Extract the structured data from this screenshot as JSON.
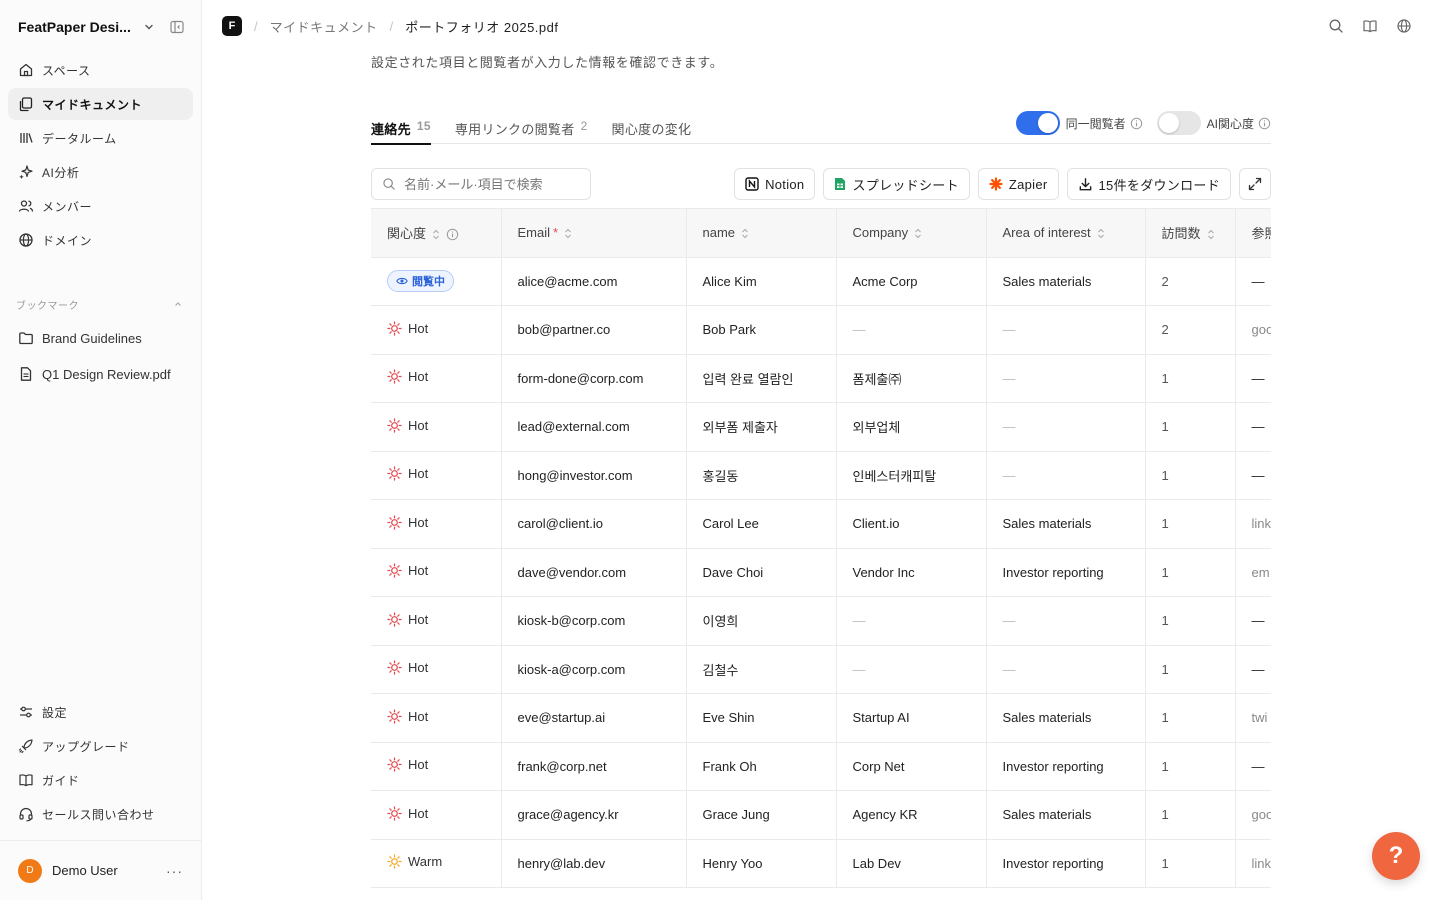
{
  "sidebar": {
    "workspace": "FeatPaper Desi...",
    "nav": [
      {
        "label": "スペース",
        "icon": "home-icon"
      },
      {
        "label": "マイドキュメント",
        "icon": "documents-icon"
      },
      {
        "label": "データルーム",
        "icon": "library-icon"
      },
      {
        "label": "AI分析",
        "icon": "sparkle-icon"
      },
      {
        "label": "メンバー",
        "icon": "users-icon"
      },
      {
        "label": "ドメイン",
        "icon": "globe-icon"
      }
    ],
    "bookmarks_title": "ブックマーク",
    "bookmarks": [
      {
        "label": "Brand Guidelines",
        "icon": "folder-icon"
      },
      {
        "label": "Q1 Design Review.pdf",
        "icon": "file-icon"
      }
    ],
    "bottom_nav": [
      {
        "label": "設定",
        "icon": "sliders-icon"
      },
      {
        "label": "アップグレード",
        "icon": "rocket-icon"
      },
      {
        "label": "ガイド",
        "icon": "book-icon"
      },
      {
        "label": "セールス問い合わせ",
        "icon": "headset-icon"
      }
    ],
    "user": {
      "initial": "D",
      "name": "Demo User",
      "more": "···"
    }
  },
  "topbar": {
    "logo": "F",
    "sep": "/",
    "crumbs": [
      "マイドキュメント",
      "ポートフォリオ 2025.pdf"
    ]
  },
  "main": {
    "description": "設定された項目と閲覧者が入力した情報を確認できます。",
    "tabs": [
      {
        "label": "連絡先",
        "count": "15"
      },
      {
        "label": "専用リンクの閲覧者",
        "count": "2"
      },
      {
        "label": "関心度の変化",
        "count": ""
      }
    ],
    "toggles": [
      {
        "label": "同一閲覧者",
        "on": true
      },
      {
        "label": "AI関心度",
        "on": false
      }
    ],
    "search_placeholder": "名前·メール·項目で検索",
    "buttons": {
      "notion": "Notion",
      "sheet": "スプレッドシート",
      "zapier": "Zapier",
      "download": "15件をダウンロード"
    },
    "columns": [
      "関心度",
      "Email",
      "name",
      "Company",
      "Area of interest",
      "訪問数",
      "参照"
    ],
    "email_required": "*",
    "rows": [
      {
        "interest": "閲覧中",
        "type": "viewing",
        "email": "alice@acme.com",
        "name": "Alice Kim",
        "company": "Acme Corp",
        "area": "Sales materials",
        "visits": "2",
        "ref": "—"
      },
      {
        "interest": "Hot",
        "type": "hot",
        "email": "bob@partner.co",
        "name": "Bob Park",
        "company": "—",
        "area": "—",
        "visits": "2",
        "ref": "goo"
      },
      {
        "interest": "Hot",
        "type": "hot",
        "email": "form-done@corp.com",
        "name": "입력 완료 열람인",
        "company": "폼제출㈜",
        "area": "—",
        "visits": "1",
        "ref": "—"
      },
      {
        "interest": "Hot",
        "type": "hot",
        "email": "lead@external.com",
        "name": "외부폼 제출자",
        "company": "외부업체",
        "area": "—",
        "visits": "1",
        "ref": "—"
      },
      {
        "interest": "Hot",
        "type": "hot",
        "email": "hong@investor.com",
        "name": "홍길동",
        "company": "인베스터캐피탈",
        "area": "—",
        "visits": "1",
        "ref": "—"
      },
      {
        "interest": "Hot",
        "type": "hot",
        "email": "carol@client.io",
        "name": "Carol Lee",
        "company": "Client.io",
        "area": "Sales materials",
        "visits": "1",
        "ref": "link"
      },
      {
        "interest": "Hot",
        "type": "hot",
        "email": "dave@vendor.com",
        "name": "Dave Choi",
        "company": "Vendor Inc",
        "area": "Investor reporting",
        "visits": "1",
        "ref": "em"
      },
      {
        "interest": "Hot",
        "type": "hot",
        "email": "kiosk-b@corp.com",
        "name": "이영희",
        "company": "—",
        "area": "—",
        "visits": "1",
        "ref": "—"
      },
      {
        "interest": "Hot",
        "type": "hot",
        "email": "kiosk-a@corp.com",
        "name": "김철수",
        "company": "—",
        "area": "—",
        "visits": "1",
        "ref": "—"
      },
      {
        "interest": "Hot",
        "type": "hot",
        "email": "eve@startup.ai",
        "name": "Eve Shin",
        "company": "Startup AI",
        "area": "Sales materials",
        "visits": "1",
        "ref": "twi"
      },
      {
        "interest": "Hot",
        "type": "hot",
        "email": "frank@corp.net",
        "name": "Frank Oh",
        "company": "Corp Net",
        "area": "Investor reporting",
        "visits": "1",
        "ref": "—"
      },
      {
        "interest": "Hot",
        "type": "hot",
        "email": "grace@agency.kr",
        "name": "Grace Jung",
        "company": "Agency KR",
        "area": "Sales materials",
        "visits": "1",
        "ref": "goo"
      },
      {
        "interest": "Warm",
        "type": "warm",
        "email": "henry@lab.dev",
        "name": "Henry Yoo",
        "company": "Lab Dev",
        "area": "Investor reporting",
        "visits": "1",
        "ref": "link"
      }
    ]
  },
  "help_label": "?",
  "colors": {
    "accent": "#2f6feb",
    "hot": "#e5484d",
    "warm": "#f5a623",
    "help": "#f0663f",
    "zapier": "#ff4f00",
    "sheets": "#1fa463"
  }
}
